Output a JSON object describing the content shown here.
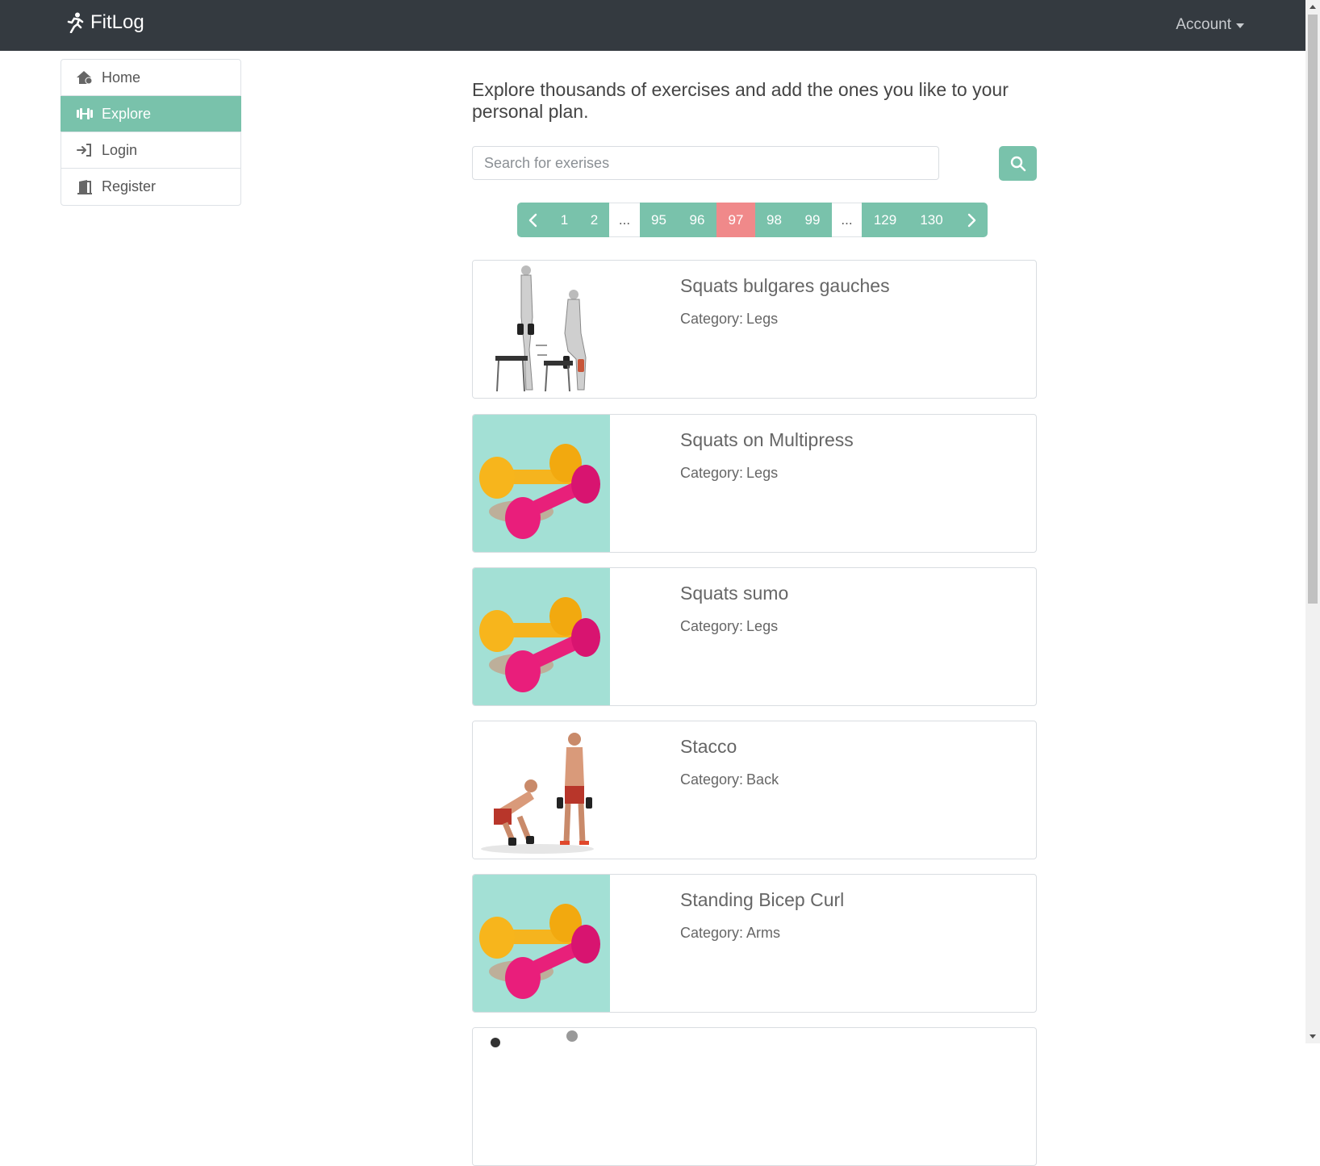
{
  "navbar": {
    "brand": "FitLog",
    "account": "Account"
  },
  "sidebar": {
    "items": [
      {
        "label": "Home",
        "icon": "home-icon"
      },
      {
        "label": "Explore",
        "icon": "dumbbell-icon",
        "active": true
      },
      {
        "label": "Login",
        "icon": "login-icon"
      },
      {
        "label": "Register",
        "icon": "door-icon"
      }
    ]
  },
  "main": {
    "intro": "Explore thousands of exercises and add the ones you like to your personal plan.",
    "search": {
      "placeholder": "Search for exerises"
    },
    "pagination": {
      "pages": [
        "1",
        "2",
        "...",
        "95",
        "96",
        "97",
        "98",
        "99",
        "...",
        "129",
        "130"
      ],
      "current": "97"
    },
    "category_label": "Category:",
    "exercises": [
      {
        "name": "Squats bulgares gauches",
        "category": "Legs",
        "image": "squat-illustration"
      },
      {
        "name": "Squats on Multipress",
        "category": "Legs",
        "image": "dumbbells-placeholder"
      },
      {
        "name": "Squats sumo",
        "category": "Legs",
        "image": "dumbbells-placeholder"
      },
      {
        "name": "Stacco",
        "category": "Back",
        "image": "deadlift-photo"
      },
      {
        "name": "Standing Bicep Curl",
        "category": "Arms",
        "image": "dumbbells-placeholder"
      }
    ]
  },
  "colors": {
    "accent": "#79c2ab",
    "current_page": "#f0898a",
    "navbar": "#343a40",
    "placeholder_bg": "#a3e0d5"
  }
}
